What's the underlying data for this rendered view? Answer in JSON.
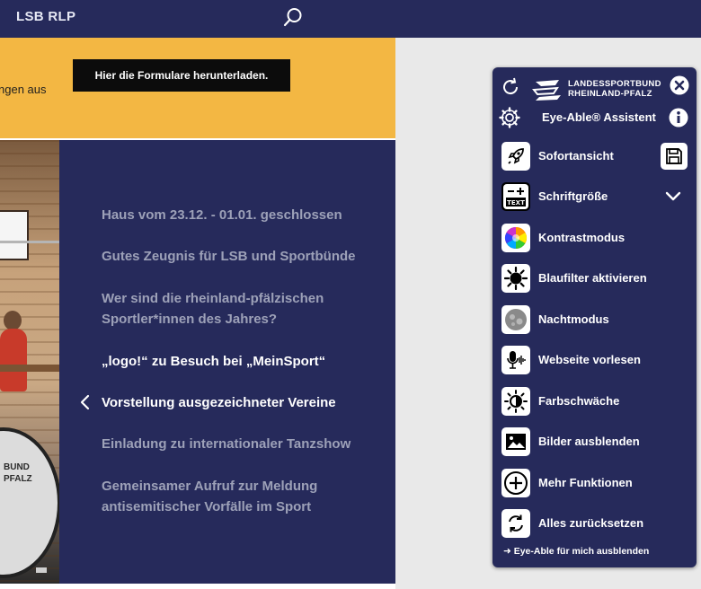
{
  "header": {
    "brand": "LSB RLP",
    "search_icon": "search-icon"
  },
  "notice": {
    "text": "ngen aus",
    "download_label": "Hier die Formulare herunterladen."
  },
  "photo": {
    "banner_text_line1": "BUND",
    "banner_text_line2": "PFALZ"
  },
  "news": {
    "items": [
      "Haus vom 23.12. - 01.01. geschlossen",
      "Gutes Zeugnis für LSB und Sportbünde",
      "Wer sind die rheinland-pfälzischen Sportler*innen des Jahres?",
      "„logo!“ zu Besuch bei „MeinSport“",
      "Vorstellung ausgezeichneter Vereine",
      "Einladung zu internationaler Tanzshow",
      "Gemeinsamer Aufruf zur Meldung antisemitischer Vorfälle im Sport"
    ],
    "highlighted": [
      "„logo!“ zu Besuch bei „MeinSport“",
      "Vorstellung ausgezeichneter Vereine"
    ]
  },
  "eyeable": {
    "logo_line1": "LANDESSPORTBUND",
    "logo_line2": "RHEINLAND-PFALZ",
    "title": "Eye-Able® Assistent",
    "functions": [
      {
        "label": "Sofortansicht",
        "icon": "rocket-icon"
      },
      {
        "label": "Schriftgröße",
        "icon": "text-size-icon"
      },
      {
        "label": "Kontrastmodus",
        "icon": "color-wheel-icon"
      },
      {
        "label": "Blaufilter aktivieren",
        "icon": "sun-icon"
      },
      {
        "label": "Nachtmodus",
        "icon": "moon-icon"
      },
      {
        "label": "Webseite vorlesen",
        "icon": "microphone-icon"
      },
      {
        "label": "Farbschwäche",
        "icon": "color-weakness-icon"
      },
      {
        "label": "Bilder ausblenden",
        "icon": "image-icon"
      },
      {
        "label": "Mehr Funktionen",
        "icon": "plus-circle-icon"
      },
      {
        "label": "Alles zurücksetzen",
        "icon": "reset-icon"
      }
    ],
    "hide_label": "➜ Eye-Able für mich ausblenden"
  },
  "colors": {
    "navy": "#262a5b",
    "accent_yellow": "#f3b743",
    "muted_text": "#9da1b8"
  }
}
